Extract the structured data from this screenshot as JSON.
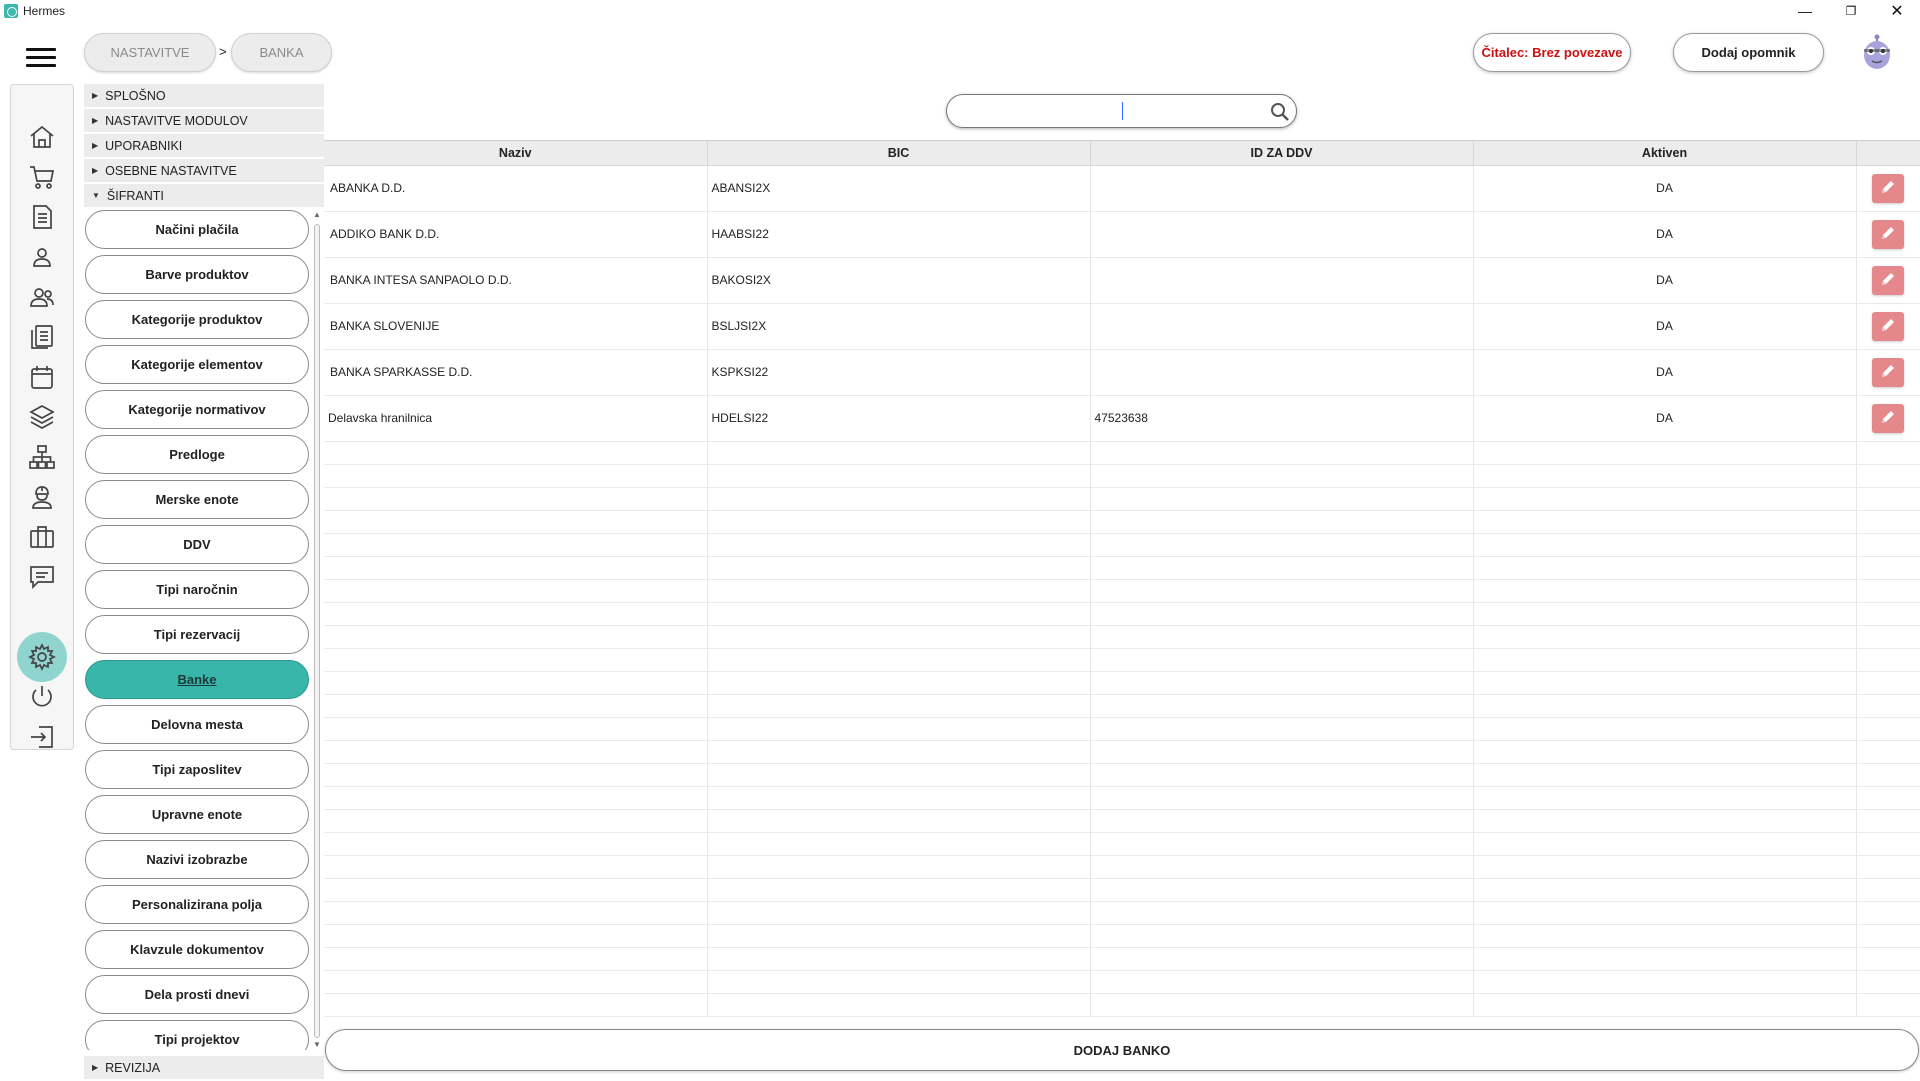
{
  "window": {
    "title": "Hermes",
    "controls": [
      "minimize",
      "restore",
      "close"
    ]
  },
  "breadcrumb": [
    "NASTAVITVE",
    "BANKA"
  ],
  "breadcrumb_separator": ">",
  "header": {
    "reader_status": "Čitalec: Brez povezave",
    "reminder_button": "Dodaj opomnik"
  },
  "rail": {
    "icons": [
      "home-icon",
      "cart-icon",
      "document-icon",
      "user-icon",
      "users-icon",
      "list-document-icon",
      "calendar-icon",
      "layers-icon",
      "sitemap-icon",
      "worker-icon",
      "briefcase-icon",
      "comment-icon"
    ],
    "bottom_icons": [
      "settings-icon",
      "power-icon",
      "exit-icon"
    ],
    "active": "settings-icon",
    "active_color": "#90d4cf"
  },
  "tree": {
    "sections_top": [
      {
        "label": "SPLOŠNO",
        "expanded": false
      },
      {
        "label": "NASTAVITVE MODULOV",
        "expanded": false
      },
      {
        "label": "UPORABNIKI",
        "expanded": false
      },
      {
        "label": "OSEBNE NASTAVITVE",
        "expanded": false
      },
      {
        "label": "ŠIFRANTI",
        "expanded": true
      }
    ],
    "items": [
      "Načini plačila",
      "Barve produktov",
      "Kategorije produktov",
      "Kategorije elementov",
      "Kategorije normativov",
      "Predloge",
      "Merske enote",
      "DDV",
      "Tipi naročnin",
      "Tipi rezervacij",
      "Banke",
      "Delovna mesta",
      "Tipi zaposlitev",
      "Upravne enote",
      "Nazivi izobrazbe",
      "Personalizirana polja",
      "Klavzule dokumentov",
      "Dela prosti dnevi",
      "Tipi projektov"
    ],
    "active_item": "Banke",
    "active_color": "#3ab5aa",
    "section_bottom": {
      "label": "REVIZIJA",
      "expanded": false
    }
  },
  "search": {
    "value": "",
    "placeholder": ""
  },
  "table": {
    "columns": [
      "Naziv",
      "BIC",
      "ID ZA DDV",
      "Aktiven",
      ""
    ],
    "rows": [
      {
        "naziv": "ABANKA D.D.",
        "bic": "ABANSI2X",
        "id_ddv": "",
        "aktiven": "DA"
      },
      {
        "naziv": "ADDIKO BANK D.D.",
        "bic": "HAABSI22",
        "id_ddv": "",
        "aktiven": "DA"
      },
      {
        "naziv": "BANKA INTESA SANPAOLO D.D.",
        "bic": "BAKOSI2X",
        "id_ddv": "",
        "aktiven": "DA"
      },
      {
        "naziv": "BANKA SLOVENIJE",
        "bic": "BSLJSI2X",
        "id_ddv": "",
        "aktiven": "DA"
      },
      {
        "naziv": "BANKA SPARKASSE D.D.",
        "bic": "KSPKSI22",
        "id_ddv": "",
        "aktiven": "DA"
      },
      {
        "naziv": "Delavska hranilnica",
        "bic": "HDELSI22",
        "id_ddv": "47523638",
        "aktiven": "DA"
      }
    ],
    "edit_icon": "pencil-icon",
    "edit_color": "#e5888c"
  },
  "add_button": "DODAJ BANKO"
}
